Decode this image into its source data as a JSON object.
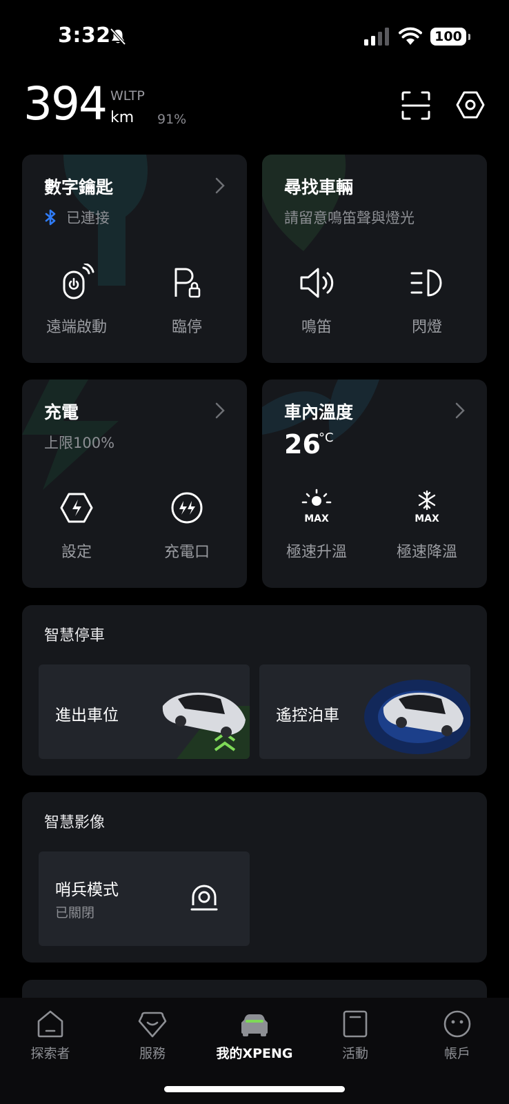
{
  "status_bar": {
    "time": "3:32",
    "battery_level": "100"
  },
  "header": {
    "range_value": "394",
    "range_standard": "WLTP",
    "range_unit": "km",
    "battery_percent": "91%"
  },
  "cards": {
    "digital_key": {
      "title": "數字鑰匙",
      "status": "已連接",
      "actions": [
        "遠端啟動",
        "臨停"
      ]
    },
    "find_car": {
      "title": "尋找車輛",
      "subtitle": "請留意鳴笛聲與燈光",
      "actions": [
        "鳴笛",
        "閃燈"
      ]
    },
    "charging": {
      "title": "充電",
      "subtitle": "上限100%",
      "actions": [
        "設定",
        "充電口"
      ]
    },
    "cabin_temp": {
      "title": "車內溫度",
      "value": "26",
      "unit": "°C",
      "actions": [
        "極速升溫",
        "極速降溫"
      ],
      "icon_badge": "MAX"
    }
  },
  "smart_parking": {
    "title": "智慧停車",
    "tiles": [
      "進出車位",
      "遙控泊車"
    ]
  },
  "smart_video": {
    "title": "智慧影像",
    "sentry": {
      "label": "哨兵模式",
      "status": "已關閉"
    }
  },
  "bottom_nav": {
    "items": [
      "探索者",
      "服務",
      "我的XPENG",
      "活動",
      "帳戶"
    ],
    "active_index": 2
  },
  "colors": {
    "background": "#000000",
    "card": "#16181c",
    "tile": "#22252b",
    "accent_green": "#7ed957",
    "bluetooth_blue": "#2f7bf6"
  }
}
